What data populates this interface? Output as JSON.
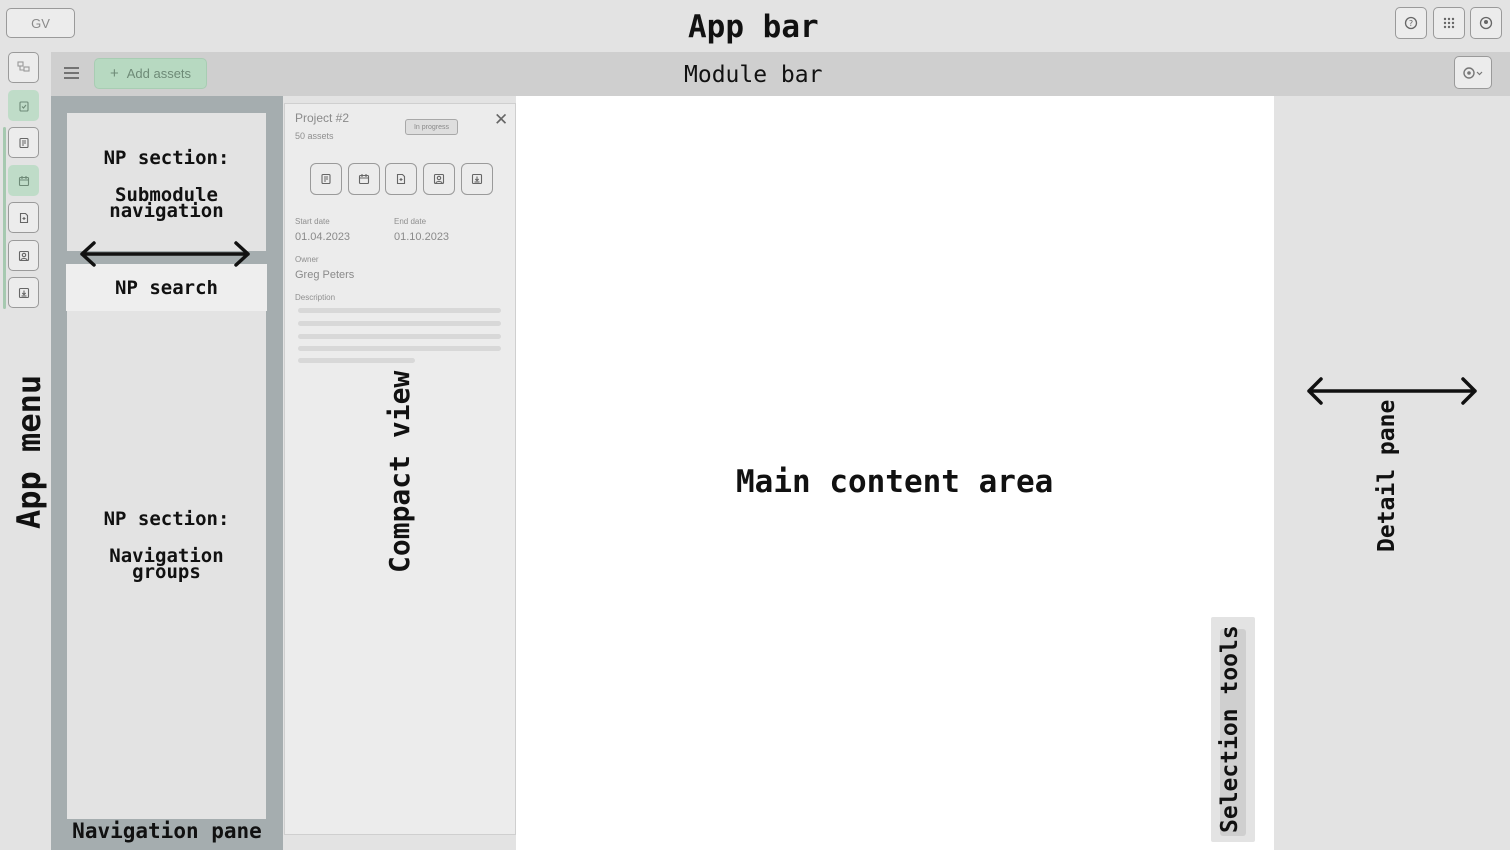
{
  "app_bar": {
    "title": "App bar",
    "user_initials": "GV",
    "icons": [
      "help-icon",
      "apps-grid-icon",
      "account-icon"
    ]
  },
  "app_menu": {
    "label": "App menu",
    "items": [
      "assets-icon",
      "checklist-icon",
      "document-icon",
      "calendar-icon",
      "file-add-icon",
      "portrait-icon",
      "download-icon"
    ]
  },
  "module_bar": {
    "title": "Module bar",
    "add_button_label": "Add assets",
    "menu_icon": "hamburger-icon",
    "right_icon": "settings-dropdown-icon"
  },
  "nav_pane": {
    "label": "Navigation pane",
    "submodule_line1": "NP section:",
    "submodule_line2": "Submodule",
    "submodule_line3": "navigation",
    "search_label": "NP search",
    "groups_line1": "NP section:",
    "groups_line2": "Navigation",
    "groups_line3": "groups"
  },
  "compact_view": {
    "label": "Compact view",
    "project_title": "Project #2",
    "asset_count": "50 assets",
    "status_badge": "In progress",
    "start_date_label": "Start date",
    "start_date": "01.04.2023",
    "end_date_label": "End date",
    "end_date": "01.10.2023",
    "owner_label": "Owner",
    "owner": "Greg Peters",
    "description_label": "Description"
  },
  "main": {
    "label": "Main content area"
  },
  "selection_tools": {
    "label": "Selection tools"
  },
  "detail_pane": {
    "label": "Detail pane"
  },
  "colors": {
    "accent_green": "#b7d9c1",
    "nav_pane": "#a5adaf",
    "bar_gray": "#cfcfcf"
  }
}
